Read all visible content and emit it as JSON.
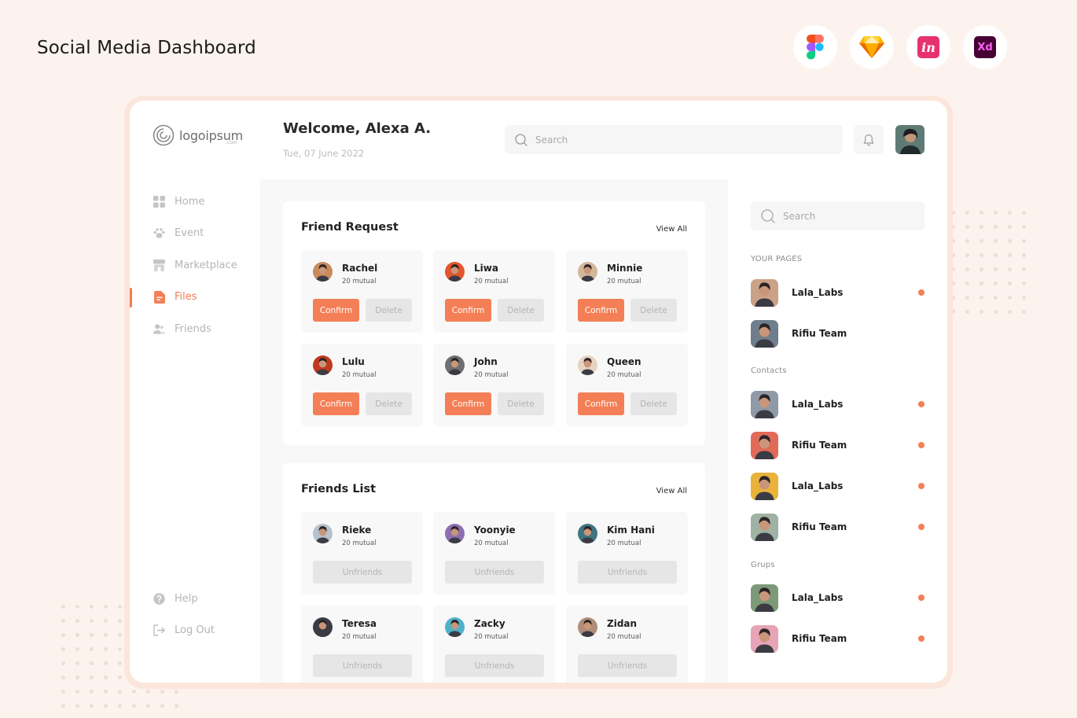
{
  "page_title": "Social Media Dashboard",
  "tools": [
    {
      "icon": "figma-icon"
    },
    {
      "icon": "sketch-icon"
    },
    {
      "icon": "invision-icon",
      "text": "in",
      "color": "#e6336f"
    },
    {
      "icon": "adobe-xd-icon",
      "text": "Xd",
      "color": "#470137"
    }
  ],
  "brand": {
    "name": "logoipsum",
    "sub": ".com"
  },
  "header": {
    "welcome": "Welcome, Alexa A.",
    "date": "Tue, 07 June 2022",
    "search_placeholder": "Search"
  },
  "nav": {
    "items": [
      {
        "label": "Home",
        "icon": "grid-icon"
      },
      {
        "label": "Event",
        "icon": "paw-icon"
      },
      {
        "label": "Marketplace",
        "icon": "store-icon"
      },
      {
        "label": "Files",
        "icon": "file-icon",
        "active": true
      },
      {
        "label": "Friends",
        "icon": "users-icon"
      }
    ],
    "bottom": [
      {
        "label": "Help",
        "icon": "help-icon"
      },
      {
        "label": "Log Out",
        "icon": "logout-icon"
      }
    ]
  },
  "friend_request": {
    "title": "Friend Request",
    "view_all": "View All",
    "confirm_label": "Confirm",
    "delete_label": "Delete",
    "items": [
      {
        "name": "Rachel",
        "mutual": "20 mutual",
        "color": "#c98a5c"
      },
      {
        "name": "Liwa",
        "mutual": "20 mutual",
        "color": "#e2552d"
      },
      {
        "name": "Minnie",
        "mutual": "20 mutual",
        "color": "#d3b79a"
      },
      {
        "name": "Lulu",
        "mutual": "20 mutual",
        "color": "#c0391e"
      },
      {
        "name": "John",
        "mutual": "20 mutual",
        "color": "#6f6f73"
      },
      {
        "name": "Queen",
        "mutual": "20 mutual",
        "color": "#e6d4c2"
      }
    ]
  },
  "friends_list": {
    "title": "Friends List",
    "view_all": "View All",
    "unfriend_label": "Unfriends",
    "items": [
      {
        "name": "Rieke",
        "mutual": "20 mutual",
        "color": "#b7c2cc"
      },
      {
        "name": "Yoonyie",
        "mutual": "20 mutual",
        "color": "#8d6fb0"
      },
      {
        "name": "Kim Hani",
        "mutual": "20 mutual",
        "color": "#3f7580"
      },
      {
        "name": "Teresa",
        "mutual": "20 mutual",
        "color": "#3c3a45"
      },
      {
        "name": "Zacky",
        "mutual": "20 mutual",
        "color": "#4fb1c9"
      },
      {
        "name": "Zidan",
        "mutual": "20 mutual",
        "color": "#b08e77"
      }
    ]
  },
  "sidebar_right": {
    "search_placeholder": "Search",
    "your_pages_label": "YOUR PAGES",
    "your_pages": [
      {
        "name": "Lala_Labs",
        "online": true,
        "color": "#caa287"
      },
      {
        "name": "Rifiu Team",
        "online": false,
        "color": "#6f7d8c"
      }
    ],
    "contacts_label": "Contacts",
    "contacts": [
      {
        "name": "Lala_Labs",
        "online": true,
        "color": "#8f9aa6"
      },
      {
        "name": "Rifiu Team",
        "online": true,
        "color": "#e26a58"
      },
      {
        "name": "Lala_Labs",
        "online": true,
        "color": "#e9b33a"
      },
      {
        "name": "Rifiu Team",
        "online": true,
        "color": "#9fb2a3"
      }
    ],
    "groups_label": "Grups",
    "groups": [
      {
        "name": "Lala_Labs",
        "online": true,
        "color": "#7d9a78"
      },
      {
        "name": "Rifiu Team",
        "online": true,
        "color": "#e7a4b6"
      }
    ]
  },
  "colors": {
    "accent": "#f47f56",
    "panel": "#ffffff",
    "background": "#fdf3ee"
  }
}
